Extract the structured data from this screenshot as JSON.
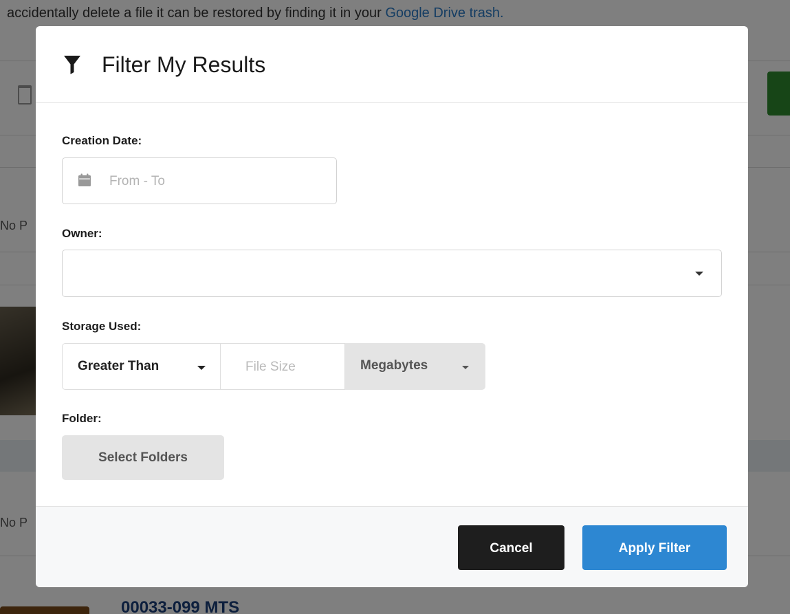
{
  "background": {
    "notice_text": "accidentally delete a file it can be restored by finding it in your ",
    "notice_link": "Google Drive trash.",
    "row_label_1": "No P",
    "row_label_2": "No P",
    "file_title": "00033-099 MTS"
  },
  "modal": {
    "title": "Filter My Results",
    "title_icon": "filter-icon",
    "creation_date": {
      "label": "Creation Date:",
      "placeholder": "From - To",
      "icon": "calendar-icon"
    },
    "owner": {
      "label": "Owner:",
      "value": ""
    },
    "storage_used": {
      "label": "Storage Used:",
      "comparison": "Greater Than",
      "size_placeholder": "File Size",
      "unit": "Megabytes"
    },
    "folder": {
      "label": "Folder:",
      "button_label": "Select Folders"
    },
    "footer": {
      "cancel_label": "Cancel",
      "apply_label": "Apply Filter"
    }
  },
  "colors": {
    "overlay": "rgba(0,0,0,0.5)",
    "apply_button": "#2d87d2",
    "cancel_button": "#1e1e1e",
    "secondary_button": "#e4e4e4",
    "link": "#2a7bc7"
  }
}
